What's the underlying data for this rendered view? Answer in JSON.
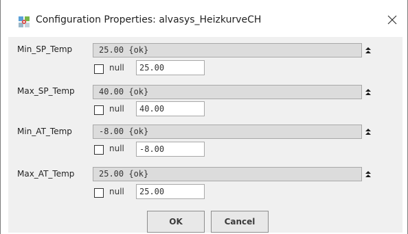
{
  "dialog": {
    "title": "Configuration Properties: alvasys_HeizkurveCH"
  },
  "properties": [
    {
      "label": "Min_SP_Temp",
      "value": "25.00 {ok}",
      "null_label": "null",
      "null_value": "25.00",
      "null_checked": false
    },
    {
      "label": "Max_SP_Temp",
      "value": "40.00 {ok}",
      "null_label": "null",
      "null_value": "40.00",
      "null_checked": false
    },
    {
      "label": "Min_AT_Temp",
      "value": "-8.00 {ok}",
      "null_label": "null",
      "null_value": "-8.00",
      "null_checked": false
    },
    {
      "label": "Max_AT_Temp",
      "value": "25.00 {ok}",
      "null_label": "null",
      "null_value": "25.00",
      "null_checked": false
    }
  ],
  "buttons": {
    "ok_label": "OK",
    "cancel_label": "Cancel"
  },
  "icons": {
    "app": "config-app-icon",
    "close": "close-icon",
    "expand": "expand-up-icon"
  },
  "colors": {
    "panel_bg": "#f0f0f0",
    "value_box_bg": "#dcdcdc",
    "field_border": "#a8a8a8"
  }
}
